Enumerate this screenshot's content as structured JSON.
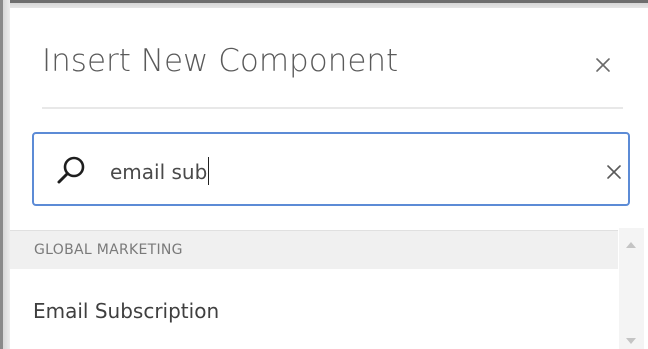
{
  "dialog": {
    "title": "Insert New Component",
    "close_icon": "close-icon"
  },
  "search": {
    "value": "email sub",
    "icon": "search-icon",
    "clear_icon": "clear-icon"
  },
  "results": {
    "groups": [
      {
        "label": "GLOBAL MARKETING",
        "items": [
          {
            "label": "Email Subscription"
          }
        ]
      }
    ]
  },
  "scrollbar": {
    "up_icon": "scroll-up-arrow",
    "down_icon": "scroll-down-arrow"
  },
  "colors": {
    "accent": "#5c8bd6",
    "title_text": "#5a5a5a",
    "group_header_bg": "#f0f0f0"
  }
}
